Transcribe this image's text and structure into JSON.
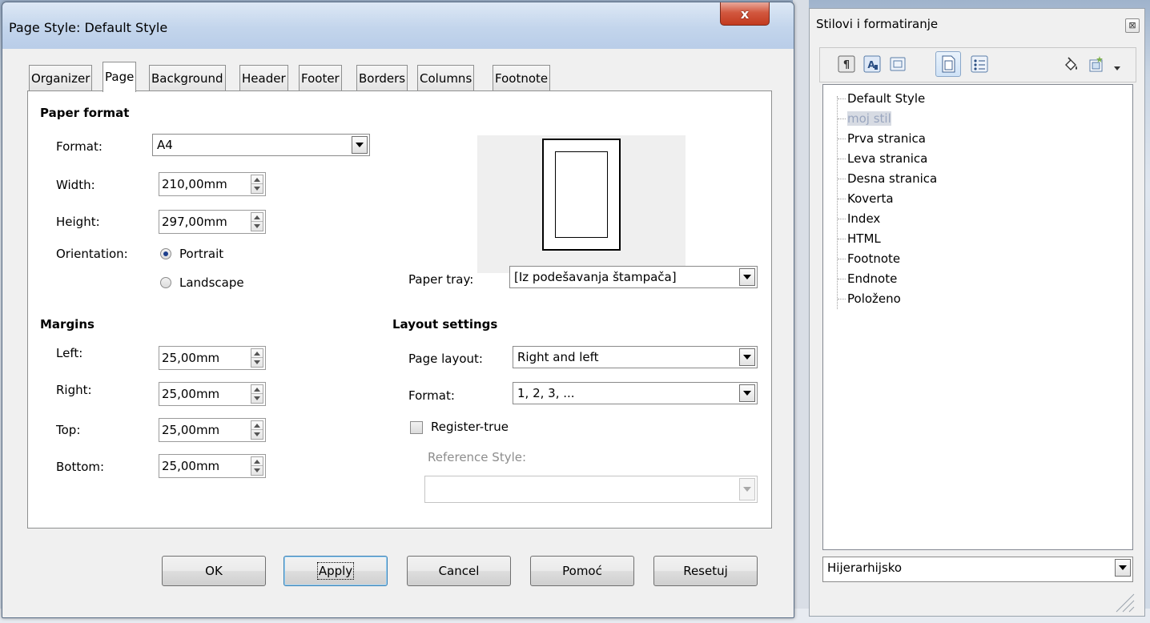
{
  "dialog": {
    "title": "Page Style: Default Style",
    "close_label": "x",
    "tabs": [
      {
        "label": "Organizer"
      },
      {
        "label": "Page",
        "active": true
      },
      {
        "label": "Background"
      },
      {
        "label": "Header"
      },
      {
        "label": "Footer"
      },
      {
        "label": "Borders"
      },
      {
        "label": "Columns"
      },
      {
        "label": "Footnote"
      }
    ],
    "paper_format": {
      "heading": "Paper format",
      "format_label": "Format:",
      "format_value": "A4",
      "width_label": "Width:",
      "width_value": "210,00mm",
      "height_label": "Height:",
      "height_value": "297,00mm",
      "orientation_label": "Orientation:",
      "portrait_label": "Portrait",
      "landscape_label": "Landscape",
      "orientation_selected": "Portrait",
      "paper_tray_label": "Paper tray:",
      "paper_tray_value": "[Iz podešavanja štampača]"
    },
    "margins": {
      "heading": "Margins",
      "left_label": "Left:",
      "left_value": "25,00mm",
      "right_label": "Right:",
      "right_value": "25,00mm",
      "top_label": "Top:",
      "top_value": "25,00mm",
      "bottom_label": "Bottom:",
      "bottom_value": "25,00mm"
    },
    "layout": {
      "heading": "Layout settings",
      "page_layout_label": "Page layout:",
      "page_layout_value": "Right and left",
      "format_label": "Format:",
      "format_value": "1, 2, 3, ...",
      "register_true_label": "Register-true",
      "register_true_checked": false,
      "reference_style_label": "Reference Style:",
      "reference_style_value": ""
    },
    "buttons": {
      "ok": "OK",
      "apply": "Apply",
      "cancel": "Cancel",
      "help": "Pomoć",
      "reset": "Resetuj"
    }
  },
  "styles_panel": {
    "title": "Stilovi i formatiranje",
    "close_label": "⊠",
    "toolbar": [
      "paragraph-styles-icon",
      "character-styles-icon",
      "frame-styles-icon",
      "page-styles-icon",
      "list-styles-icon",
      "fill-format-icon",
      "new-style-icon"
    ],
    "items": [
      {
        "label": "Default Style"
      },
      {
        "label": "moj stil",
        "selected": true
      },
      {
        "label": "Prva stranica"
      },
      {
        "label": "Leva stranica"
      },
      {
        "label": "Desna stranica"
      },
      {
        "label": "Koverta"
      },
      {
        "label": "Index"
      },
      {
        "label": "HTML"
      },
      {
        "label": "Footnote"
      },
      {
        "label": "Endnote"
      },
      {
        "label": "Položeno"
      }
    ],
    "filter_value": "Hijerarhijsko"
  },
  "colors": {
    "close_red": "#c33a1f",
    "selection_highlight": "#d7dbe3",
    "default_button_border": "#3c7fb1"
  }
}
